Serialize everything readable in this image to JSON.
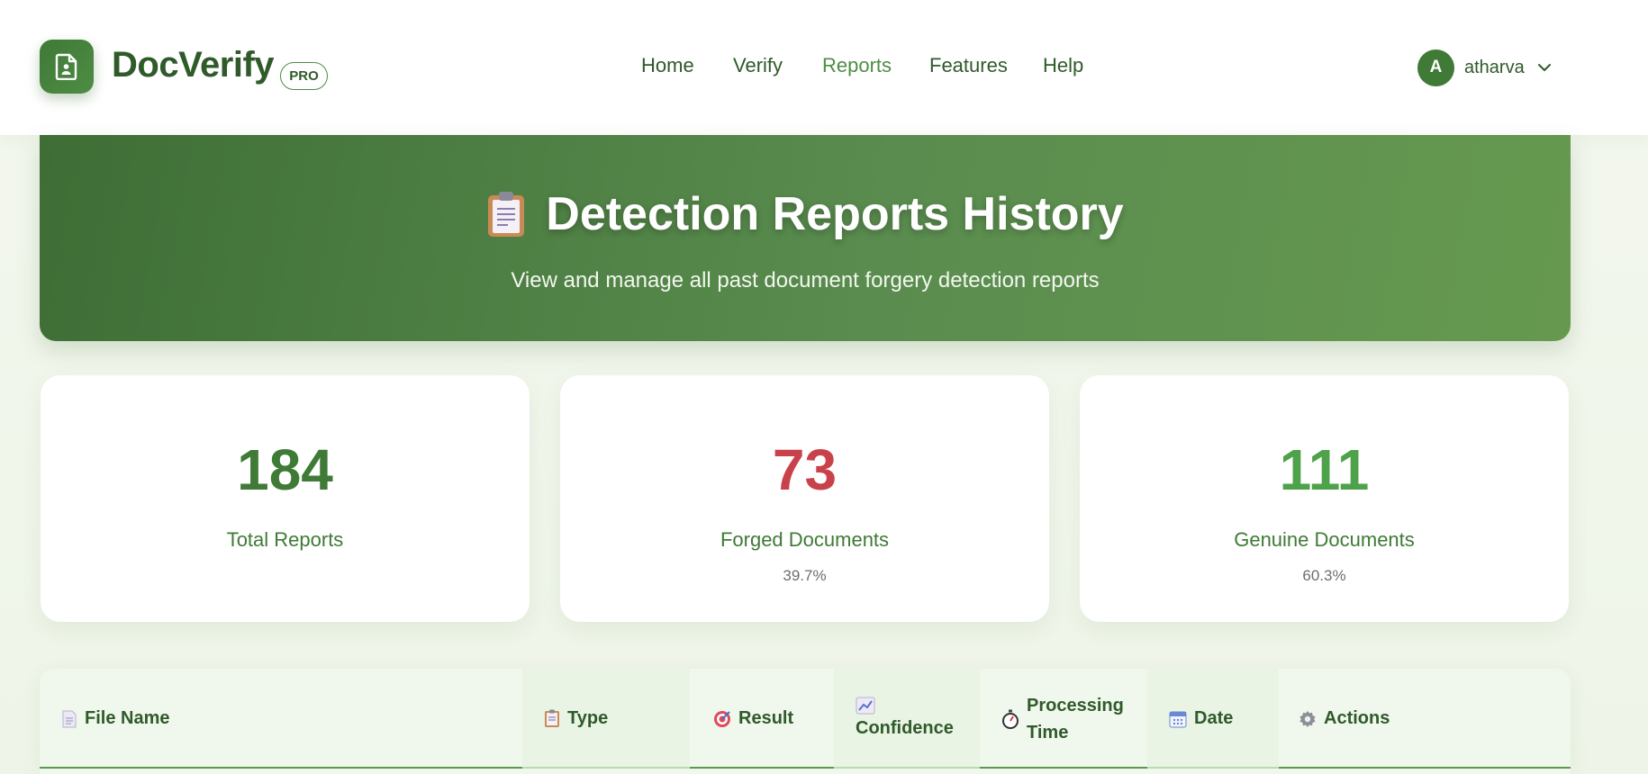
{
  "header": {
    "brand": "DocVerify",
    "badge": "PRO",
    "nav": [
      "Home",
      "Verify",
      "Reports",
      "Features",
      "Help"
    ],
    "active_nav": "Reports",
    "user": {
      "initial": "A",
      "name": "atharva"
    }
  },
  "hero": {
    "icon": "clipboard-icon",
    "title": "Detection Reports History",
    "subtitle": "View and manage all past document forgery detection reports"
  },
  "stats": [
    {
      "value": "184",
      "label": "Total Reports",
      "percent": "",
      "color": "#3f7a36"
    },
    {
      "value": "73",
      "label": "Forged Documents",
      "percent": "39.7%",
      "color": "#c9414a"
    },
    {
      "value": "111",
      "label": "Genuine Documents",
      "percent": "60.3%",
      "color": "#4ea24a"
    }
  ],
  "table": {
    "headers": [
      {
        "icon": "document-icon",
        "label": "File Name"
      },
      {
        "icon": "clipboard-icon",
        "label": "Type"
      },
      {
        "icon": "target-icon",
        "label": "Result"
      },
      {
        "icon": "chart-icon",
        "label": "Confidence"
      },
      {
        "icon": "stopwatch-icon",
        "label": "Processing Time"
      },
      {
        "icon": "calendar-icon",
        "label": "Date"
      },
      {
        "icon": "gear-icon",
        "label": "Actions"
      }
    ]
  },
  "colors": {
    "brand_green": "#3f7a36",
    "forged_red": "#c9414a",
    "genuine_green": "#4ea24a",
    "hero_start": "#3e6e35",
    "hero_end": "#66994f"
  }
}
